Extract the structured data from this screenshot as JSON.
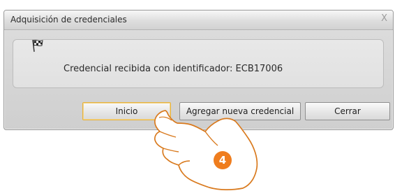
{
  "dialog": {
    "title": "Adquisición de credenciales",
    "close_label": "X",
    "message": "Credencial recibida con identificador: ECB17006",
    "buttons": {
      "start_label": "Inicio",
      "add_label": "Agregar nueva credencial",
      "close_label": "Cerrar"
    }
  },
  "annotation": {
    "step_number": "4",
    "badge_color": "#ef7d1e"
  },
  "icons": {
    "message_icon": "checkered-flag-icon",
    "pointer": "hand-pointer-icon"
  }
}
